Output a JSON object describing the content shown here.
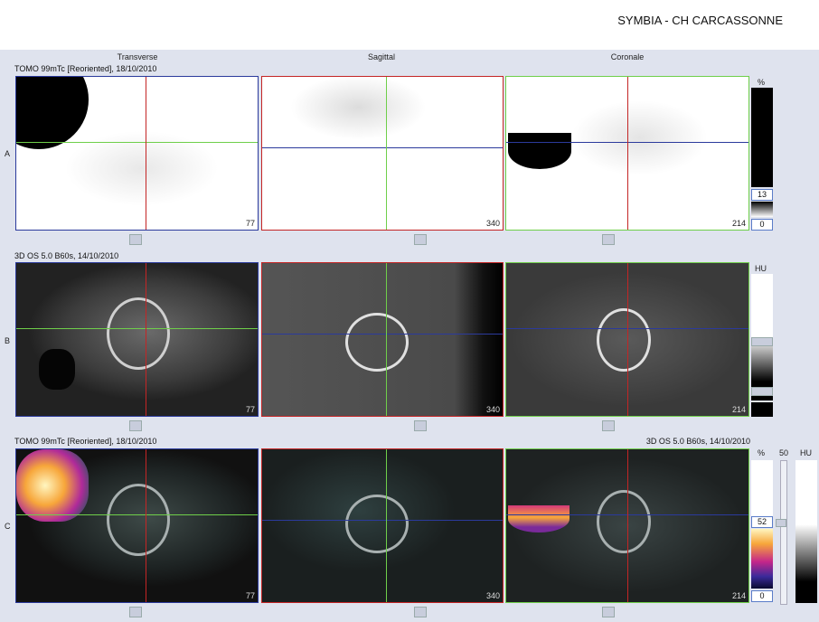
{
  "header": {
    "site": "SYMBIA - CH CARCASSONNE"
  },
  "columns": [
    "Transverse",
    "Sagittal",
    "Coronale"
  ],
  "rows": [
    {
      "letter": "A",
      "info_left": "TOMO 99mTc [Reoriented], 18/10/2010",
      "info_right": ""
    },
    {
      "letter": "B",
      "info_left": "3D  OS  5.0  B60s, 14/10/2010",
      "info_right": ""
    },
    {
      "letter": "C",
      "info_left": "TOMO 99mTc [Reoriented], 18/10/2010",
      "info_right": "3D  OS  5.0  B60s, 14/10/2010"
    }
  ],
  "slices": {
    "transverse": "77",
    "sagittal": "340",
    "coronal": "214"
  },
  "scale_a": {
    "unit": "%",
    "value": "13",
    "min": "0"
  },
  "scale_b": {
    "unit": "HU"
  },
  "scale_c": {
    "unit": "%",
    "value": "52",
    "min": "0",
    "second_value": "50",
    "second_unit": "HU"
  },
  "colors": {
    "transverse_border": "#2b3a9c",
    "sagittal_border": "#c42525",
    "coronal_border": "#6fcf4a"
  }
}
